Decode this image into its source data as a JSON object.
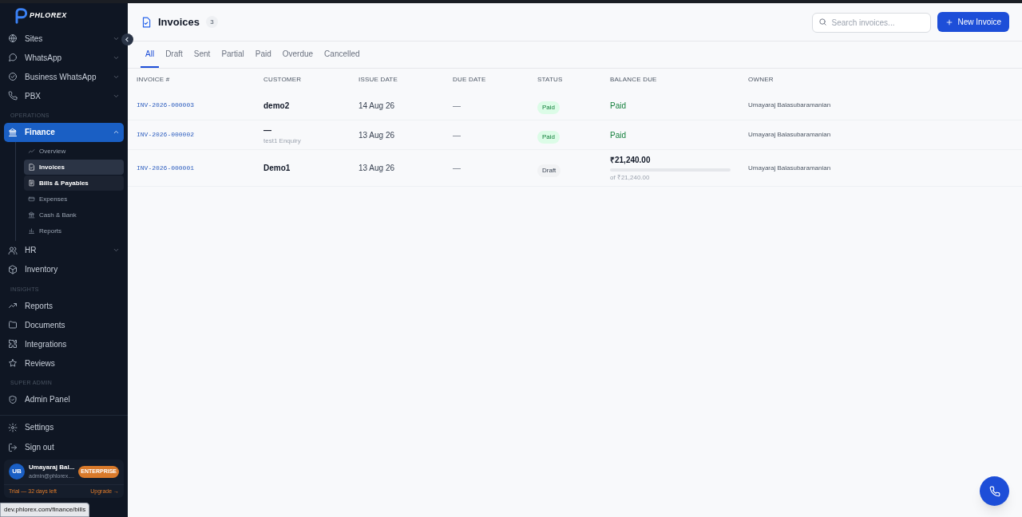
{
  "sidebar": {
    "logo": "PHLOREX",
    "nav": [
      {
        "kind": "item",
        "label": "Sites",
        "expanded": false,
        "selected": false
      },
      {
        "kind": "item",
        "label": "WhatsApp",
        "expanded": false,
        "selected": false
      },
      {
        "kind": "item",
        "label": "Business WhatsApp",
        "expanded": false,
        "selected": false
      },
      {
        "kind": "item",
        "label": "PBX",
        "expanded": false,
        "selected": false
      },
      {
        "kind": "section",
        "label": "OPERATIONS"
      },
      {
        "kind": "item",
        "label": "Finance",
        "expanded": true,
        "selected": true,
        "children": [
          {
            "label": "Overview",
            "selected": false,
            "hovered": false
          },
          {
            "label": "Invoices",
            "selected": true,
            "hovered": false
          },
          {
            "label": "Bills & Payables",
            "selected": false,
            "hovered": true
          },
          {
            "label": "Expenses",
            "selected": false,
            "hovered": false
          },
          {
            "label": "Cash & Bank",
            "selected": false,
            "hovered": false
          },
          {
            "label": "Reports",
            "selected": false,
            "hovered": false
          }
        ]
      },
      {
        "kind": "item",
        "label": "HR",
        "expanded": false,
        "selected": false
      },
      {
        "kind": "item",
        "label": "Inventory",
        "selected": false
      },
      {
        "kind": "section",
        "label": "INSIGHTS"
      },
      {
        "kind": "item",
        "label": "Reports",
        "selected": false
      },
      {
        "kind": "item",
        "label": "Documents",
        "selected": false
      },
      {
        "kind": "item",
        "label": "Integrations",
        "selected": false
      },
      {
        "kind": "item",
        "label": "Reviews",
        "selected": false
      },
      {
        "kind": "section",
        "label": "SUPER ADMIN"
      },
      {
        "kind": "item",
        "label": "Admin Panel",
        "selected": false
      }
    ],
    "bottom": [
      {
        "label": "Settings"
      },
      {
        "label": "Sign out"
      }
    ],
    "user": {
      "initials": "UB",
      "name": "Umayaraj Bal...",
      "email": "admin@phlorex....",
      "plan": "ENTERPRISE"
    },
    "trial": {
      "text": "Trial — 32 days left",
      "link": "Upgrade →"
    }
  },
  "header": {
    "title": "Invoices",
    "count": "3",
    "search": {
      "placeholder": "Search invoices..."
    },
    "new_button": "New Invoice"
  },
  "tabs": [
    {
      "label": "All",
      "selected": true
    },
    {
      "label": "Draft",
      "selected": false
    },
    {
      "label": "Sent",
      "selected": false
    },
    {
      "label": "Partial",
      "selected": false
    },
    {
      "label": "Paid",
      "selected": false
    },
    {
      "label": "Overdue",
      "selected": false
    },
    {
      "label": "Cancelled",
      "selected": false
    }
  ],
  "table": {
    "columns": [
      "INVOICE #",
      "CUSTOMER",
      "ISSUE DATE",
      "DUE DATE",
      "STATUS",
      "BALANCE DUE",
      "OWNER"
    ],
    "rows": [
      {
        "invoice": "INV-2026-000003",
        "customer": "demo2",
        "issue_date": "14 Aug 26",
        "due_date": "—",
        "status": {
          "kind": "paid",
          "label": "Paid"
        },
        "balance": {
          "kind": "paid",
          "text": "Paid"
        },
        "owner": "Umayaraj Balasubaramanian"
      },
      {
        "invoice": "INV-2026-000002",
        "customer": "—",
        "customer_note": "test1 Enquiry",
        "issue_date": "13 Aug 26",
        "due_date": "—",
        "status": {
          "kind": "paid",
          "label": "Paid"
        },
        "balance": {
          "kind": "paid",
          "text": "Paid"
        },
        "owner": "Umayaraj Balasubaramanian"
      },
      {
        "invoice": "INV-2026-000001",
        "customer": "Demo1",
        "issue_date": "13 Aug 26",
        "due_date": "—",
        "status": {
          "kind": "draft",
          "label": "Draft"
        },
        "balance": {
          "kind": "amount",
          "text": "₹21,240.00",
          "level": 0,
          "of": "of ₹21,240.00"
        },
        "owner": "Umayaraj Balasubaramanian"
      }
    ]
  },
  "link_preview": "dev.phlorex.com/finance/bills"
}
